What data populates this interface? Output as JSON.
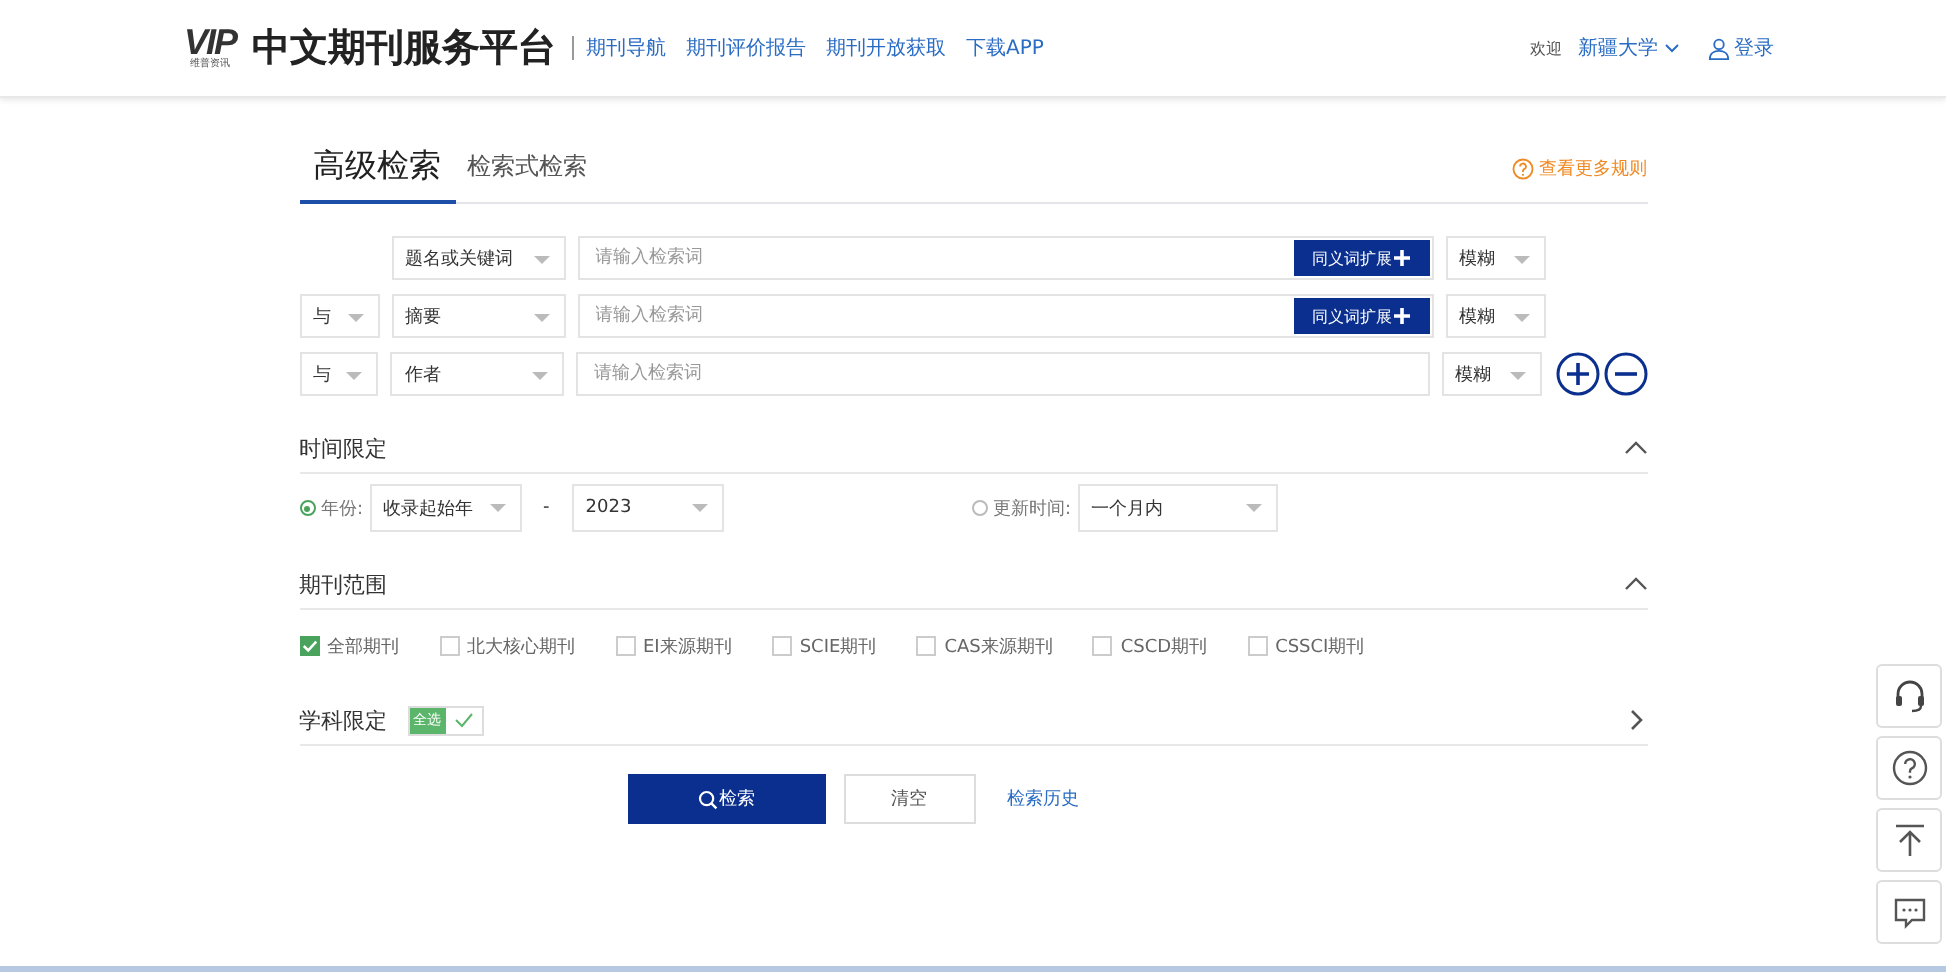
{
  "header": {
    "logo_mark": "VIP",
    "logo_sub": "维普资讯",
    "title": "中文期刊服务平台",
    "nav": [
      "期刊导航",
      "期刊评价报告",
      "期刊开放获取",
      "下载APP"
    ],
    "welcome": "欢迎",
    "org": "新疆大学",
    "login": "登录"
  },
  "tabs": [
    {
      "label": "高级检索",
      "selected": true
    },
    {
      "label": "检索式检索",
      "selected": false
    }
  ],
  "rules_link": "查看更多规则",
  "rows": [
    {
      "field": "题名或关键词",
      "placeholder": "请输入检索词",
      "synonym_button": "同义词扩展",
      "match": "模糊"
    },
    {
      "logic": "与",
      "field": "摘要",
      "placeholder": "请输入检索词",
      "synonym_button": "同义词扩展",
      "match": "模糊"
    },
    {
      "logic": "与",
      "field": "作者",
      "placeholder": "请输入检索词",
      "match": "模糊"
    }
  ],
  "time": {
    "title": "时间限定",
    "expanded": true,
    "separator": "-",
    "options": [
      {
        "kind": "range",
        "label": "年份:",
        "selected": true,
        "from": "收录起始年",
        "to": "2023"
      },
      {
        "kind": "single",
        "label": "更新时间:",
        "selected": false,
        "value": "一个月内"
      }
    ]
  },
  "journal_scope": {
    "title": "期刊范围",
    "expanded": true,
    "items": [
      {
        "label": "全部期刊",
        "checked": true
      },
      {
        "label": "北大核心期刊",
        "checked": false
      },
      {
        "label": "EI来源期刊",
        "checked": false
      },
      {
        "label": "SCIE期刊",
        "checked": false
      },
      {
        "label": "CAS来源期刊",
        "checked": false
      },
      {
        "label": "CSCD期刊",
        "checked": false
      },
      {
        "label": "CSSCI期刊",
        "checked": false
      }
    ]
  },
  "subject": {
    "title": "学科限定",
    "expanded": false,
    "all_label": "全选",
    "all_checked": true
  },
  "actions": {
    "search": "检索",
    "clear": "清空",
    "history": "检索历史"
  }
}
